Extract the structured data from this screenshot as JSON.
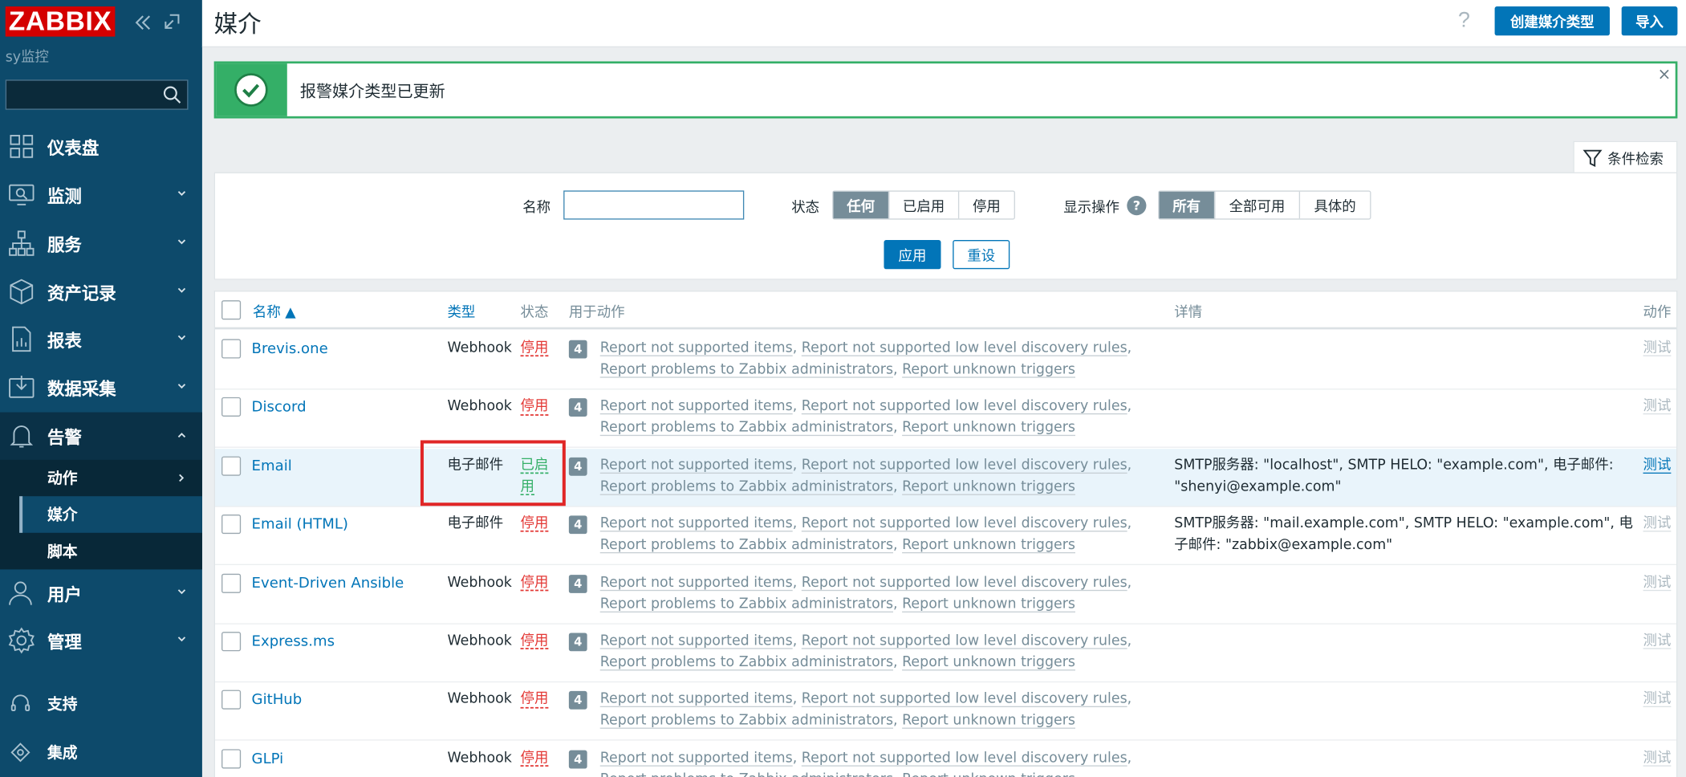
{
  "sidebar": {
    "logo": "ZABBIX",
    "instance": "sy监控",
    "search_placeholder": "",
    "items": [
      {
        "label": "仪表盘"
      },
      {
        "label": "监测"
      },
      {
        "label": "服务"
      },
      {
        "label": "资产记录"
      },
      {
        "label": "报表"
      },
      {
        "label": "数据采集"
      },
      {
        "label": "告警"
      },
      {
        "label": "用户"
      },
      {
        "label": "管理"
      }
    ],
    "subitems": [
      {
        "label": "动作"
      },
      {
        "label": "媒介"
      },
      {
        "label": "脚本"
      }
    ],
    "footer": [
      {
        "label": "支持"
      },
      {
        "label": "集成"
      }
    ]
  },
  "header": {
    "title": "媒介",
    "help": "?",
    "create_button": "创建媒介类型",
    "import_button": "导入"
  },
  "message": {
    "text": "报警媒介类型已更新",
    "close": "×"
  },
  "filter": {
    "tab_label": "条件检索",
    "name_label": "名称",
    "name_value": "",
    "status_label": "状态",
    "status_options": [
      "任何",
      "已启用",
      "停用"
    ],
    "status_selected": 0,
    "actions_label": "显示操作",
    "actions_help": "?",
    "actions_options": [
      "所有",
      "全部可用",
      "具体的"
    ],
    "actions_selected": 0,
    "apply_button": "应用",
    "reset_button": "重设"
  },
  "table": {
    "columns": {
      "name": "名称 ▲",
      "type": "类型",
      "status": "状态",
      "used_in_actions": "用于动作",
      "details": "详情",
      "action": "动作"
    },
    "action_links": [
      "Report not supported items",
      "Report not supported low level discovery rules",
      "Report problems to Zabbix administrators",
      "Report unknown triggers"
    ],
    "action_count": "4",
    "test_label": "测试",
    "rows": [
      {
        "name": "Brevis.one",
        "type": "Webhook",
        "status": "停用",
        "enabled": false,
        "details": ""
      },
      {
        "name": "Discord",
        "type": "Webhook",
        "status": "停用",
        "enabled": false,
        "details": ""
      },
      {
        "name": "Email",
        "type": "电子邮件",
        "status": "已启用",
        "enabled": true,
        "details": "SMTP服务器: \"localhost\", SMTP HELO: \"example.com\", 电子邮件: \"shenyi@example.com\""
      },
      {
        "name": "Email (HTML)",
        "type": "电子邮件",
        "status": "停用",
        "enabled": false,
        "details": "SMTP服务器: \"mail.example.com\", SMTP HELO: \"example.com\", 电子邮件: \"zabbix@example.com\""
      },
      {
        "name": "Event-Driven Ansible",
        "type": "Webhook",
        "status": "停用",
        "enabled": false,
        "details": ""
      },
      {
        "name": "Express.ms",
        "type": "Webhook",
        "status": "停用",
        "enabled": false,
        "details": ""
      },
      {
        "name": "GitHub",
        "type": "Webhook",
        "status": "停用",
        "enabled": false,
        "details": ""
      },
      {
        "name": "GLPi",
        "type": "Webhook",
        "status": "停用",
        "enabled": false,
        "details": ""
      }
    ]
  },
  "colors": {
    "sidebar_bg": "#0d4a6b",
    "accent": "#0275b8",
    "success": "#34af67",
    "danger": "#e33734",
    "highlight_box": "#e02626"
  }
}
